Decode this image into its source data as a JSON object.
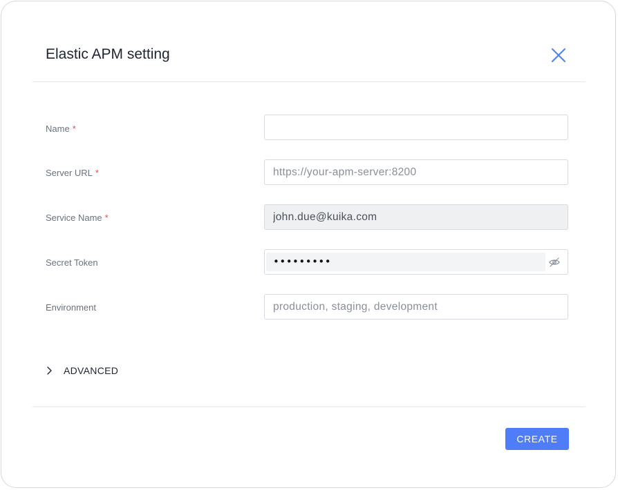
{
  "dialog": {
    "title": "Elastic APM setting",
    "close_icon": "close-icon"
  },
  "form": {
    "name": {
      "label": "Name",
      "required_mark": "*",
      "value": "",
      "placeholder": ""
    },
    "server_url": {
      "label": "Server URL",
      "required_mark": "*",
      "value": "",
      "placeholder": "https://your-apm-server:8200"
    },
    "service_name": {
      "label": "Service Name",
      "required_mark": "*",
      "value": "john.due@kuika.com",
      "disabled": true
    },
    "secret_token": {
      "label": "Secret Token",
      "masked_value": "•••••••••",
      "toggle_icon": "eye-off-icon"
    },
    "environment": {
      "label": "Environment",
      "value": "",
      "placeholder": "production, staging, development"
    }
  },
  "advanced": {
    "label": "ADVANCED",
    "icon": "chevron-right-icon",
    "expanded": false
  },
  "footer": {
    "create_label": "CREATE"
  },
  "colors": {
    "accent": "#4f7df7",
    "required": "#e5484d",
    "close_icon": "#4f7df7"
  }
}
